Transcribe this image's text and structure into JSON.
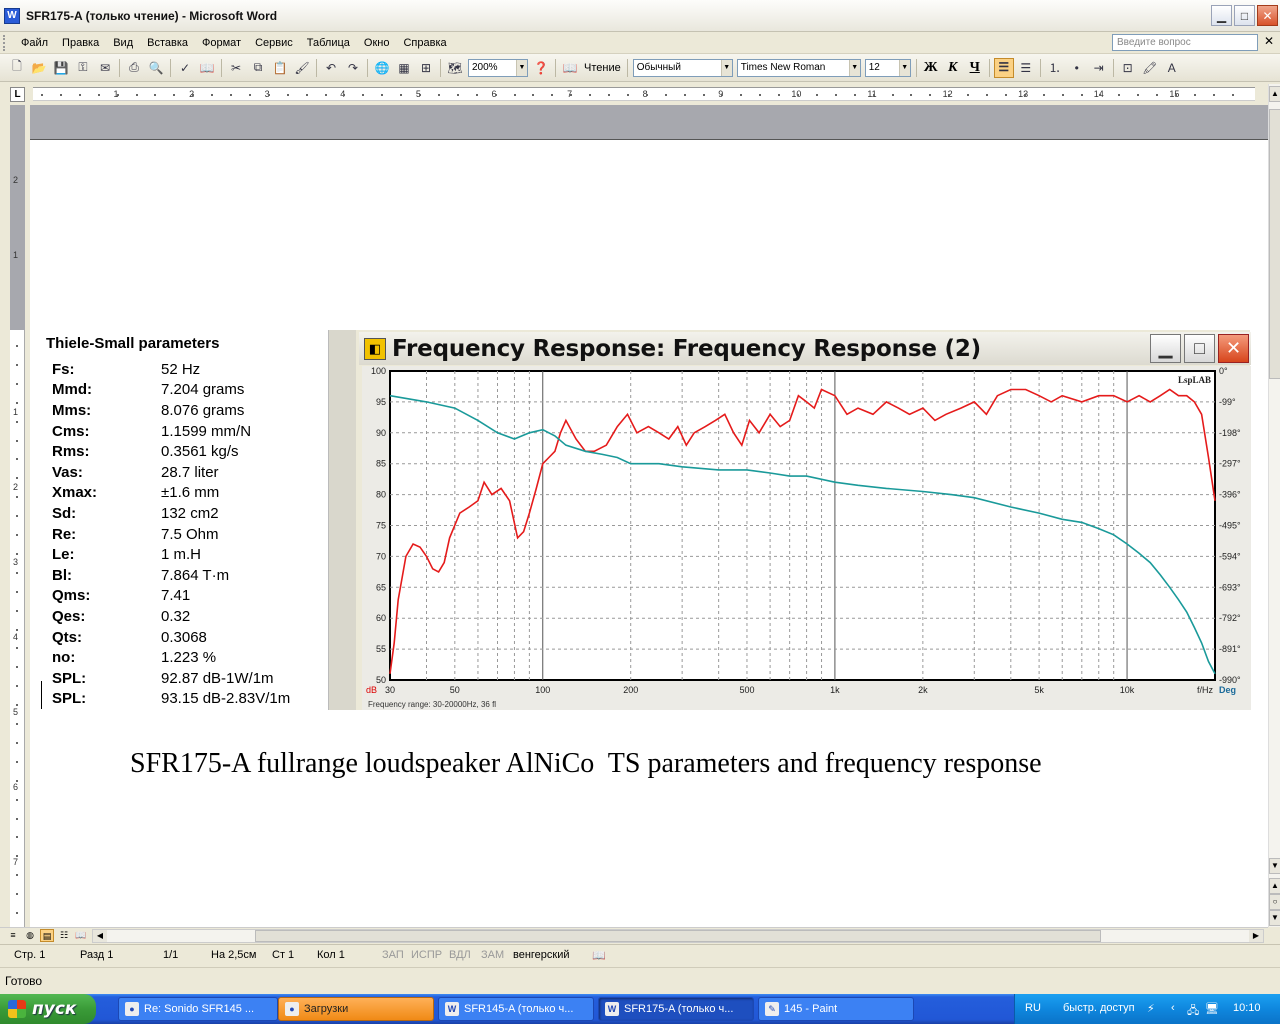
{
  "window": {
    "title": "SFR175-A (только чтение) - Microsoft Word",
    "app_icon": "word-icon"
  },
  "menu": {
    "items": [
      "Файл",
      "Правка",
      "Вид",
      "Вставка",
      "Формат",
      "Сервис",
      "Таблица",
      "Окно",
      "Справка"
    ],
    "ask_placeholder": "Введите вопрос"
  },
  "toolbar": {
    "zoom": "200%",
    "reading_label": "Чтение",
    "style": "Обычный",
    "font": "Times New Roman",
    "size": "12",
    "bold": "Ж",
    "italic": "К",
    "underline": "Ч"
  },
  "ruler": {
    "numbers": [
      "1",
      "2",
      "3",
      "4",
      "5",
      "6",
      "7",
      "8",
      "9",
      "10",
      "11",
      "12",
      "13",
      "14",
      "15"
    ]
  },
  "vruler": {
    "numbers": [
      "2",
      "1",
      "1",
      "2",
      "3",
      "4",
      "5",
      "6",
      "7"
    ]
  },
  "ts": {
    "title": "Thiele-Small parameters",
    "rows": [
      {
        "label": "Fs:",
        "value": "52 Hz"
      },
      {
        "label": "Mmd:",
        "value": "7.204 grams"
      },
      {
        "label": "Mms:",
        "value": "8.076 grams"
      },
      {
        "label": "Cms:",
        "value": "1.1599 mm/N"
      },
      {
        "label": "Rms:",
        "value": "0.3561 kg/s"
      },
      {
        "label": "Vas:",
        "value": "28.7 liter"
      },
      {
        "label": "Xmax:",
        "value": "±1.6 mm"
      },
      {
        "label": "Sd:",
        "value": "132 cm2"
      },
      {
        "label": "Re:",
        "value": "7.5 Ohm"
      },
      {
        "label": "Le:",
        "value": "1 m.H"
      },
      {
        "label": "Bl:",
        "value": "7.864 T·m"
      },
      {
        "label": "Qms:",
        "value": "7.41"
      },
      {
        "label": "Qes:",
        "value": "0.32"
      },
      {
        "label": "Qts:",
        "value": "0.3068"
      },
      {
        "label": "no:",
        "value": "1.223 %"
      },
      {
        "label": "SPL:",
        "value": "92.87 dB-1W/1m"
      },
      {
        "label": "SPL:",
        "value": "93.15 dB-2.83V/1m"
      }
    ]
  },
  "chart_window": {
    "title": "Frequency Response: Frequency Response (2)"
  },
  "chart_data": {
    "type": "line",
    "title": "",
    "xscale": "log",
    "xlim": [
      30,
      20000
    ],
    "ylim": [
      50,
      100
    ],
    "y2lim": [
      -990,
      0
    ],
    "grid": true,
    "xticks": [
      {
        "v": 30,
        "t": "30"
      },
      {
        "v": 50,
        "t": "50"
      },
      {
        "v": 100,
        "t": "100"
      },
      {
        "v": 200,
        "t": "200"
      },
      {
        "v": 500,
        "t": "500"
      },
      {
        "v": 1000,
        "t": "1k"
      },
      {
        "v": 2000,
        "t": "2k"
      },
      {
        "v": 5000,
        "t": "5k"
      },
      {
        "v": 10000,
        "t": "10k"
      }
    ],
    "yticks": [
      100,
      95,
      90,
      85,
      80,
      75,
      70,
      65,
      60,
      55,
      50
    ],
    "y2ticks": [
      "0°",
      "-99°",
      "-198°",
      "-297°",
      "-396°",
      "-495°",
      "-594°",
      "-693°",
      "-792°",
      "-891°",
      "-990°"
    ],
    "y_unit": "dB",
    "x_unit": "f/Hz",
    "y2_unit": "Deg",
    "brand": "LspLAB",
    "footer": "Frequency range: 30-20000Hz, 36 fl",
    "series": [
      {
        "color": "#e51b1b",
        "x": [
          30,
          31,
          32,
          34,
          36,
          38,
          40,
          42,
          44,
          46,
          48,
          52,
          56,
          60,
          63,
          67,
          72,
          77,
          82,
          86,
          90,
          95,
          100,
          105,
          110,
          115,
          120,
          130,
          140,
          150,
          165,
          180,
          195,
          210,
          230,
          250,
          270,
          290,
          310,
          330,
          360,
          390,
          420,
          450,
          480,
          510,
          550,
          600,
          650,
          700,
          750,
          800,
          850,
          900,
          1000,
          1100,
          1200,
          1350,
          1500,
          1650,
          1800,
          2000,
          2200,
          2400,
          2700,
          3000,
          3300,
          3600,
          4000,
          4500,
          5000,
          5500,
          6000,
          7000,
          8000,
          9000,
          10000,
          11000,
          12000,
          13000,
          14000,
          15000,
          16000,
          17000,
          18000,
          19000,
          20000
        ],
        "y": [
          51,
          56,
          63,
          70,
          72,
          71.5,
          70,
          68,
          67.5,
          69,
          73,
          77,
          78,
          79,
          82,
          80,
          81,
          79,
          73,
          74,
          77,
          81,
          85,
          86,
          87,
          90,
          92,
          89,
          87,
          87,
          88,
          91,
          93,
          90,
          91,
          90,
          89,
          91,
          88,
          90,
          91,
          92,
          93,
          90,
          88,
          92,
          90,
          93,
          91,
          92,
          96,
          95,
          94,
          97,
          96,
          93,
          94,
          93,
          95,
          94,
          93,
          94,
          92,
          93,
          94,
          95,
          93,
          96,
          97,
          97,
          96,
          95,
          96,
          95,
          96,
          96,
          95,
          96,
          95,
          96,
          97,
          96,
          96,
          95,
          93,
          86,
          79
        ]
      },
      {
        "color": "#1a9a9a",
        "x": [
          30,
          40,
          50,
          60,
          70,
          80,
          90,
          100,
          110,
          120,
          140,
          160,
          180,
          200,
          250,
          300,
          400,
          500,
          600,
          700,
          800,
          1000,
          1200,
          1500,
          2000,
          2500,
          3000,
          4000,
          5000,
          6000,
          7000,
          8000,
          9000,
          10000,
          11000,
          12000,
          13000,
          14000,
          15000,
          16000,
          17000,
          18000,
          19000,
          20000
        ],
        "y": [
          96,
          95,
          94,
          92,
          90,
          89,
          90,
          90.5,
          89.5,
          88,
          87,
          86.5,
          86,
          85,
          85,
          84.5,
          84,
          84,
          83.5,
          83,
          83,
          82,
          81.5,
          81,
          80.5,
          80,
          79.5,
          78,
          77,
          76,
          75.5,
          74.5,
          73.5,
          72,
          70.5,
          69,
          67,
          65,
          63,
          61,
          58.5,
          56,
          53,
          51
        ]
      }
    ]
  },
  "caption": "SFR175-A fullrange loudspeaker AlNiCo  TS parameters and frequency response",
  "status": {
    "page": "Стр. 1",
    "section": "Разд 1",
    "pages": "1/1",
    "at": "На 2,5см",
    "line": "Ст 1",
    "col": "Кол 1",
    "rec": "ЗАП",
    "trk": "ИСПР",
    "ext": "ВДЛ",
    "ovr": "ЗАМ",
    "lang": "венгерский",
    "ready": "Готово"
  },
  "taskbar": {
    "start": "пуск",
    "tasks": [
      {
        "label": "Re: Sonido SFR145 ...",
        "icon": "firefox-icon"
      },
      {
        "label": "Загрузки",
        "icon": "firefox-icon"
      },
      {
        "label": "SFR145-A (только ч...",
        "icon": "word-icon"
      },
      {
        "label": "SFR175-A (только ч...",
        "icon": "word-icon"
      },
      {
        "label": "145 - Paint",
        "icon": "paint-icon"
      }
    ],
    "lang": "RU",
    "quick": "быстр. доступ",
    "clock": "10:10"
  },
  "colors": {
    "accent": "#fbd184",
    "taskbar": "#245edc",
    "red_curve": "#e51b1b",
    "teal_curve": "#1a9a9a"
  }
}
